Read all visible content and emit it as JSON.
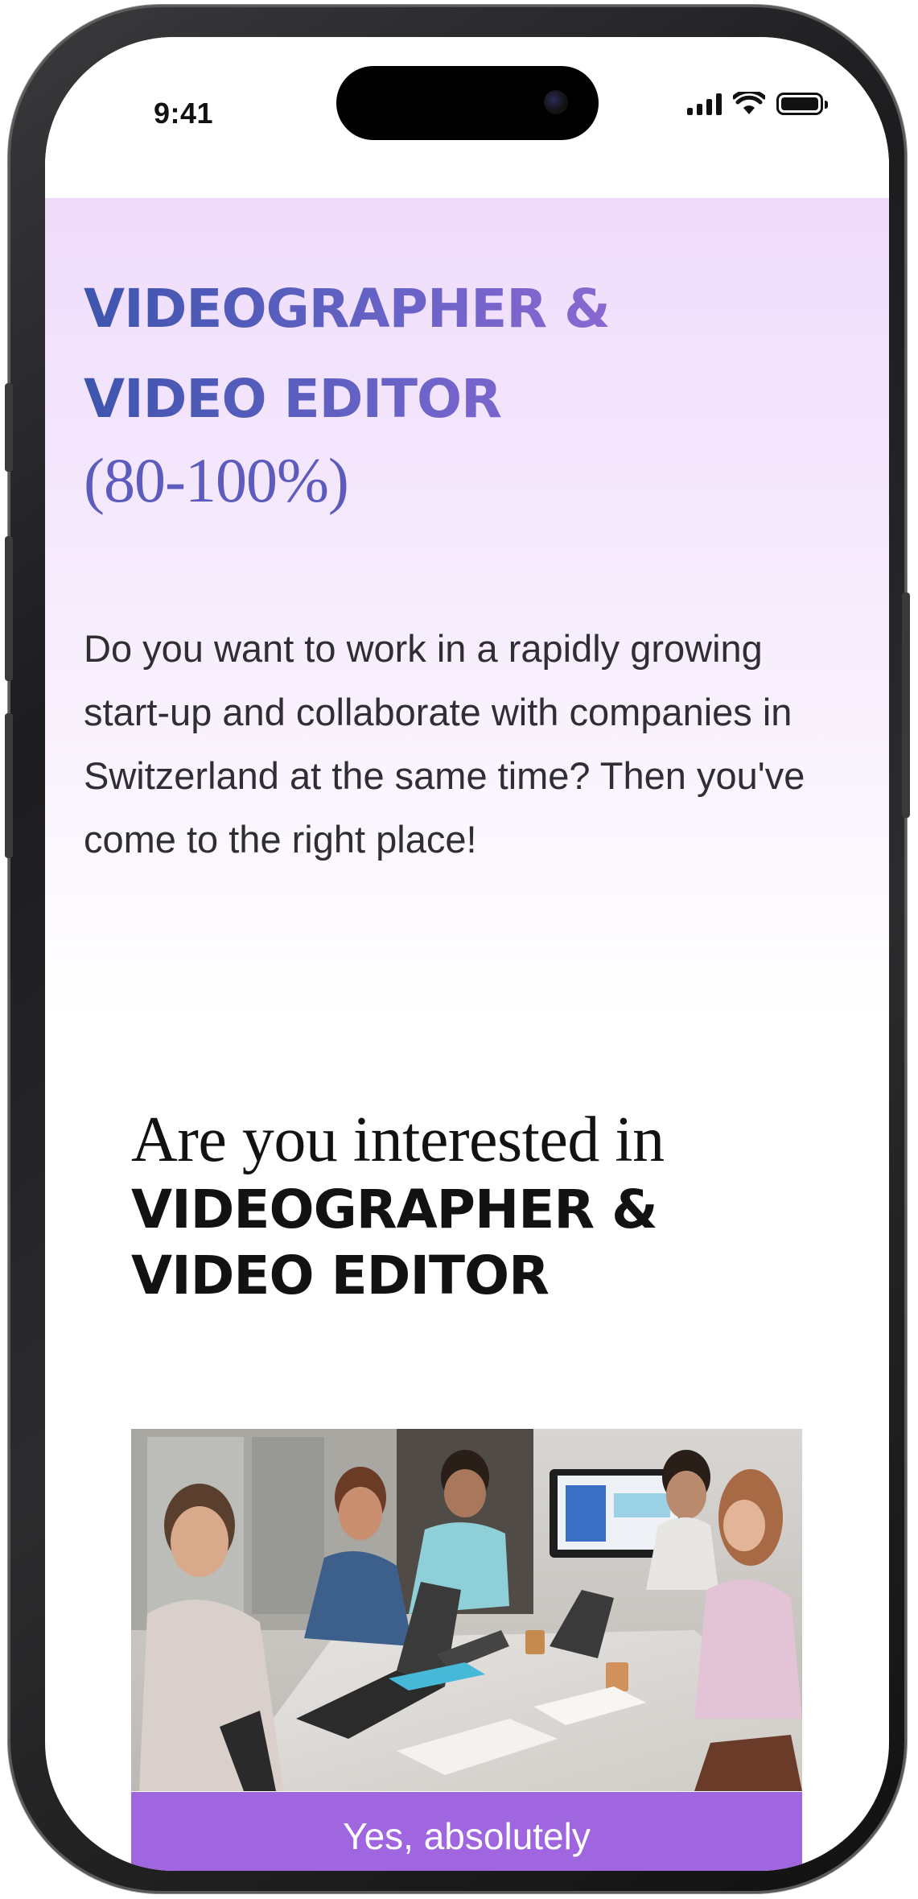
{
  "status_bar": {
    "time": "9:41",
    "icons": [
      "signal-icon",
      "wifi-icon",
      "battery-icon"
    ]
  },
  "hero": {
    "title": "VIDEOGRAPHER &\nVIDEO EDITOR",
    "subtitle": "(80-100%)",
    "description": "Do you want to work in a rapidly growing start-up and collaborate with companies in Switzerland at the same time? Then you've come to the right place!"
  },
  "interest": {
    "prefix": "Are you interested in",
    "title": "VIDEOGRAPHER &\nVIDEO EDITOR"
  },
  "photo": {
    "subject": "team-meeting-photo"
  },
  "cta": {
    "label": "Yes, absolutely"
  },
  "colors": {
    "title_gradient_start": "#3d55ad",
    "title_gradient_end": "#9d6ad6",
    "subtitle": "#5d5bbe",
    "hero_background": "#efdcfb",
    "cta_background": "#a066e0",
    "cta_text": "#ffffff",
    "body_text": "#2e2e33",
    "heading_text": "#121212"
  }
}
